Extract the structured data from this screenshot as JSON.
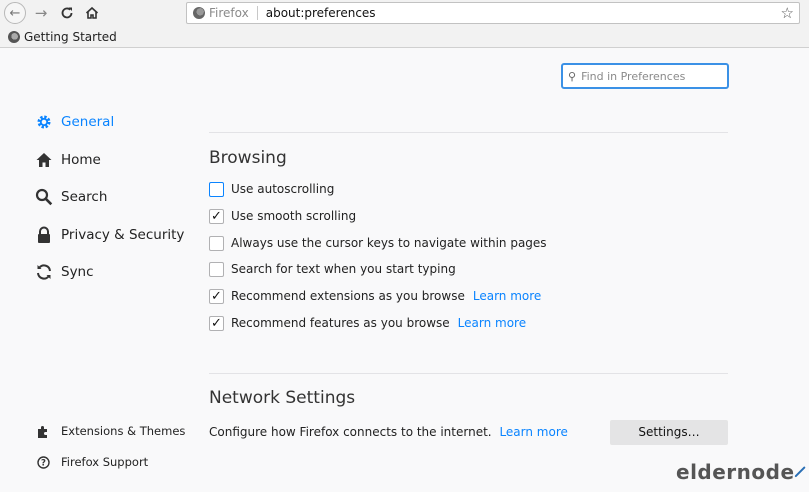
{
  "browser": {
    "identity_label": "Firefox",
    "url": "about:preferences",
    "bookmark_label": "Getting Started"
  },
  "search": {
    "placeholder": "Find in Preferences"
  },
  "sidebar": {
    "items": [
      {
        "label": "General",
        "icon": "gear-icon",
        "selected": true
      },
      {
        "label": "Home",
        "icon": "home-icon"
      },
      {
        "label": "Search",
        "icon": "search-icon"
      },
      {
        "label": "Privacy & Security",
        "icon": "lock-icon"
      },
      {
        "label": "Sync",
        "icon": "sync-icon"
      }
    ],
    "footer": [
      {
        "label": "Extensions & Themes",
        "icon": "puzzle-icon"
      },
      {
        "label": "Firefox Support",
        "icon": "help-icon"
      }
    ]
  },
  "browsing": {
    "title": "Browsing",
    "options": [
      {
        "label": "Use autoscrolling",
        "checked": false
      },
      {
        "label": "Use smooth scrolling",
        "checked": true
      },
      {
        "label": "Always use the cursor keys to navigate within pages",
        "checked": false
      },
      {
        "label": "Search for text when you start typing",
        "checked": false
      },
      {
        "label": "Recommend extensions as you browse",
        "checked": true,
        "link": "Learn more"
      },
      {
        "label": "Recommend features as you browse",
        "checked": true,
        "link": "Learn more"
      }
    ]
  },
  "network": {
    "title": "Network Settings",
    "description": "Configure how Firefox connects to the internet.",
    "link": "Learn more",
    "button": "Settings…"
  },
  "watermark": {
    "text": "eldernode"
  },
  "colors": {
    "accent": "#0a84ff",
    "focus": "#3b91e6"
  }
}
